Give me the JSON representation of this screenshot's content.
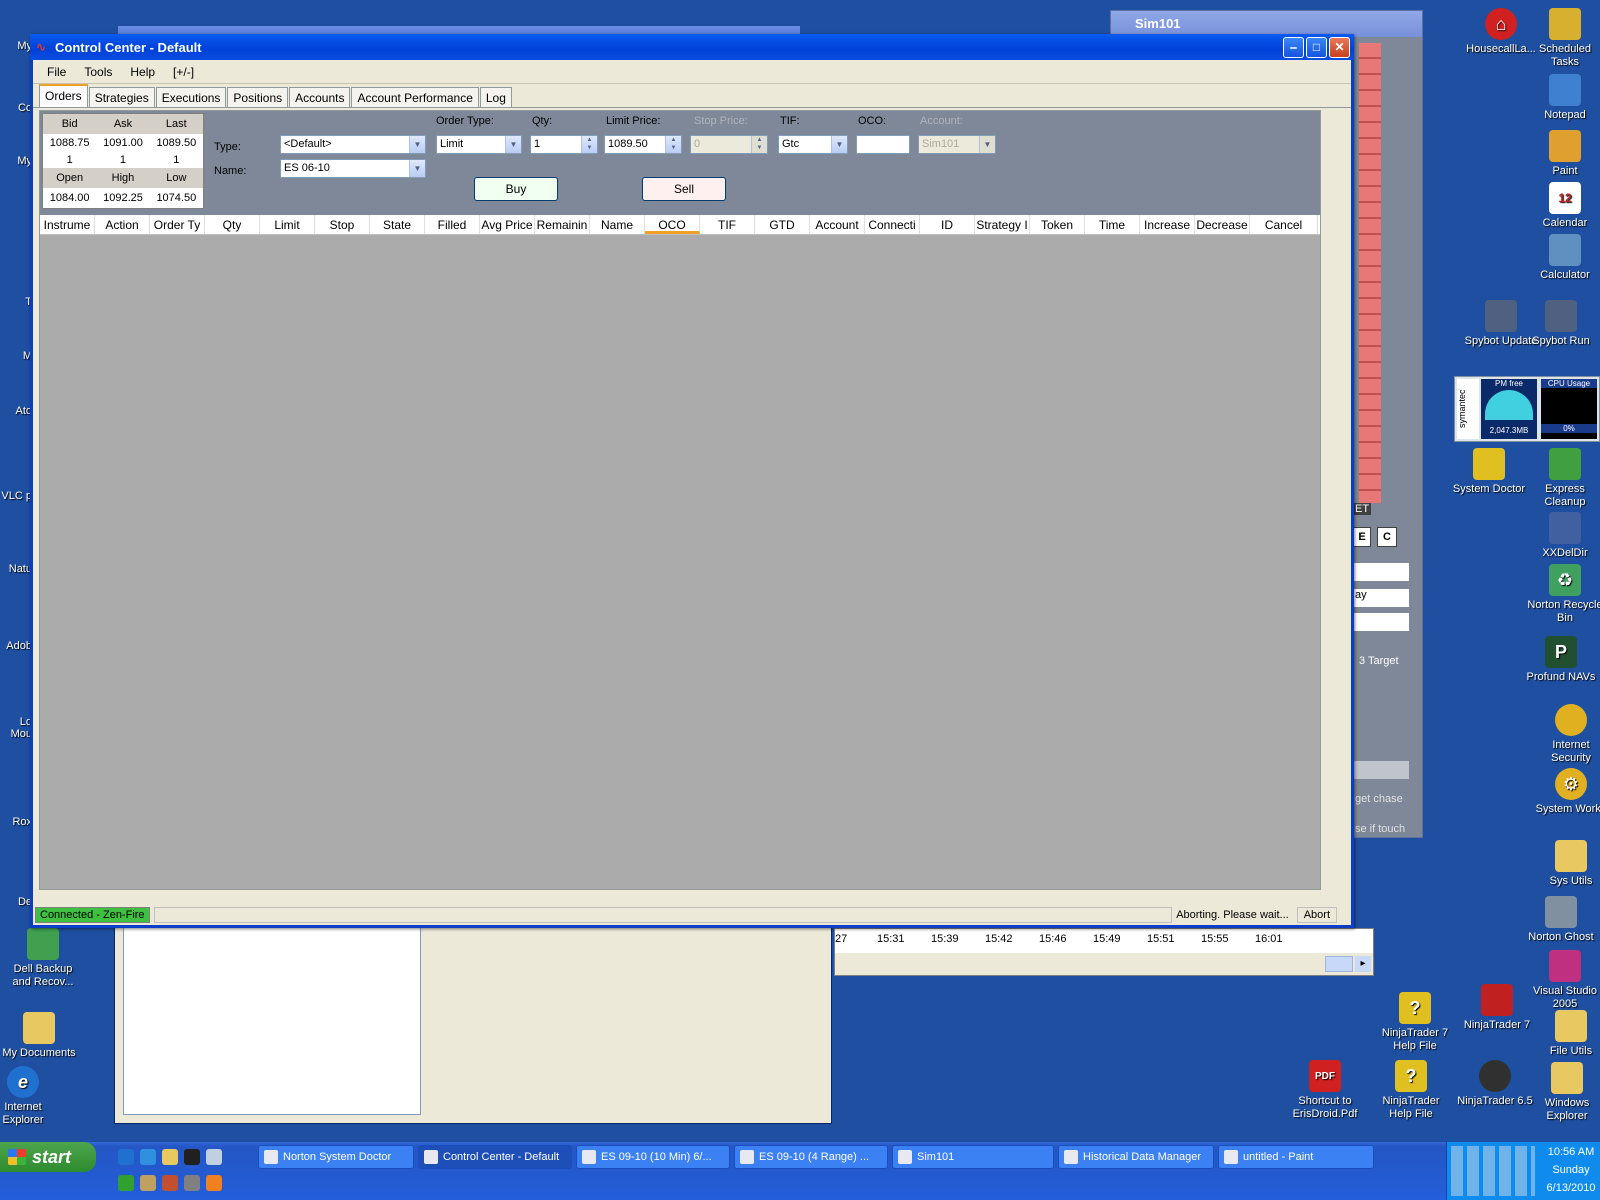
{
  "window": {
    "title": "Control Center - Default",
    "menu": [
      "File",
      "Tools",
      "Help",
      "[+/-]"
    ],
    "tabs": [
      "Orders",
      "Strategies",
      "Executions",
      "Positions",
      "Accounts",
      "Account Performance",
      "Log"
    ]
  },
  "market": {
    "hdr1": [
      "Bid",
      "Ask",
      "Last"
    ],
    "row1": [
      "1088.75",
      "1091.00",
      "1089.50"
    ],
    "row2": [
      "1",
      "1",
      "1"
    ],
    "hdr2": [
      "Open",
      "High",
      "Low"
    ],
    "row3": [
      "1084.00",
      "1092.25",
      "1074.50"
    ]
  },
  "order": {
    "type_label": "Type:",
    "type_value": "<Default>",
    "name_label": "Name:",
    "name_value": "ES 06-10",
    "order_type_label": "Order Type:",
    "order_type_value": "Limit",
    "qty_label": "Qty:",
    "qty_value": "1",
    "limit_label": "Limit Price:",
    "limit_value": "1089.50",
    "stop_label": "Stop Price:",
    "stop_value": "0",
    "tif_label": "TIF:",
    "tif_value": "Gtc",
    "oco_label": "OCO:",
    "oco_value": "",
    "account_label": "Account:",
    "account_value": "Sim101",
    "buy": "Buy",
    "sell": "Sell"
  },
  "columns": [
    "Instrume",
    "Action",
    "Order Ty",
    "Qty",
    "Limit",
    "Stop",
    "State",
    "Filled",
    "Avg Price",
    "Remainin",
    "Name",
    "OCO",
    "TIF",
    "GTD",
    "Account",
    "Connecti",
    "ID",
    "Strategy I",
    "Token",
    "Time",
    "Increase",
    "Decrease",
    "Cancel"
  ],
  "status": {
    "connection": "Connected - Zen-Fire",
    "message": "Aborting. Please wait...",
    "abort": "Abort"
  },
  "bg": {
    "sim_title": "Sim101",
    "chart_times": [
      "27",
      "15:31",
      "15:39",
      "15:42",
      "15:46",
      "15:49",
      "15:51",
      "15:55",
      "16:01"
    ],
    "target_text": "3 Target",
    "chase_text": "get chase",
    "touch_text": "se if touch",
    "day_text": "ay",
    "cet_text": "ET",
    "e_btn": "E",
    "c_btn": "C"
  },
  "desktop_right": [
    {
      "label": "HousecallLa...",
      "color": "#d02020"
    },
    {
      "label": "Scheduled Tasks",
      "color": "#d8b030"
    },
    {
      "label": "Notepad",
      "color": "#4080d0"
    },
    {
      "label": "Paint",
      "color": "#e0a030"
    },
    {
      "label": "Calendar",
      "color": "#2050a0"
    },
    {
      "label": "Calculator",
      "color": "#6090c0"
    },
    {
      "label": "Spybot Update",
      "color": "#506080"
    },
    {
      "label": "Spybot Run",
      "color": "#506080"
    },
    {
      "label": "System Doctor",
      "color": "#e0c020"
    },
    {
      "label": "Express Cleanup",
      "color": "#40a040"
    },
    {
      "label": "XXDelDir",
      "color": "#4060a0"
    },
    {
      "label": "Norton Recycle Bin",
      "color": "#40a060"
    },
    {
      "label": "Profund NAVs",
      "color": "#205030"
    },
    {
      "label": "Internet Security",
      "color": "#e0b020"
    },
    {
      "label": "System Works",
      "color": "#e0b020"
    },
    {
      "label": "Sys Utils",
      "color": "#e8c860"
    },
    {
      "label": "Norton Ghost",
      "color": "#8090a0"
    },
    {
      "label": "Visual Studio 2005",
      "color": "#c03080"
    },
    {
      "label": "File Utils",
      "color": "#e8c860"
    },
    {
      "label": "Windows Explorer",
      "color": "#e8c860"
    },
    {
      "label": "NinjaTrader 7",
      "color": "#c02020"
    },
    {
      "label": "NinjaTrader 7 Help File",
      "color": "#e0c020"
    },
    {
      "label": "NinjaTrader Help File",
      "color": "#e0c020"
    },
    {
      "label": "NinjaTrader 6.5",
      "color": "#303030"
    },
    {
      "label": "Shortcut to ErisDroid.Pdf",
      "color": "#d02020"
    }
  ],
  "desktop_left": [
    {
      "label": "Dell Backup and Recov...",
      "color": "#40a050"
    },
    {
      "label": "My Documents",
      "color": "#e8c860"
    },
    {
      "label": "Internet Explorer",
      "color": "#2070d0"
    }
  ],
  "left_edge": [
    "My",
    "Co",
    "My",
    "T",
    "M",
    "Ato",
    "VLC p",
    "Natu",
    "Adob",
    "Lo Mou",
    "Rox",
    "De"
  ],
  "gauge": {
    "pm_free": "PM free",
    "pm_value": "2,047.3MB",
    "cpu": "CPU Usage",
    "cpu_value": "0%",
    "brand": "symantec"
  },
  "taskbar": {
    "start": "start",
    "tasks": [
      "Norton System Doctor",
      "Control Center - Default",
      "ES 09-10 (10 Min)  6/...",
      "ES 09-10 (4 Range)  ...",
      "Sim101",
      "Historical Data Manager",
      "untitled - Paint"
    ],
    "time": "10:56 AM",
    "day": "Sunday",
    "date": "6/13/2010"
  }
}
